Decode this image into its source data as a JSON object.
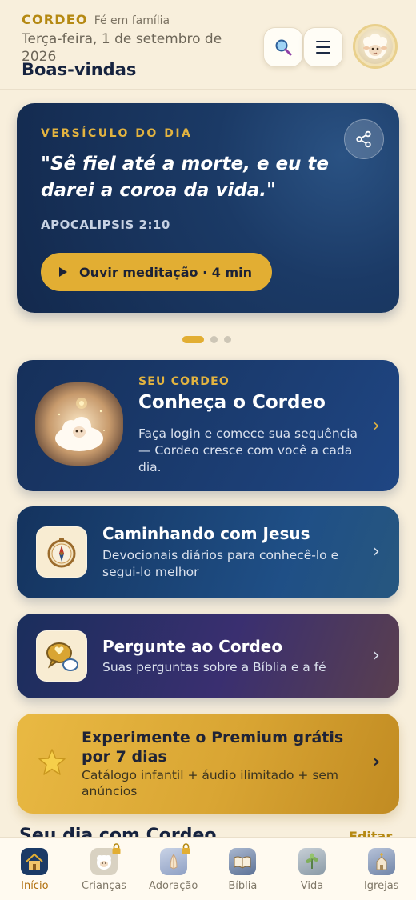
{
  "header": {
    "brand": "CORDEO",
    "tagline": "Fé em família",
    "date": "Terça-feira, 1 de setembro de 2026",
    "welcome": "Boas-vindas",
    "search_icon": "search-icon",
    "menu_icon": "menu-icon",
    "avatar_icon": "lamb-avatar-icon"
  },
  "verse": {
    "label": "VERSÍCULO DO DIA",
    "text": "\"Sê fiel até a morte, e eu te darei a coroa da vida.\"",
    "reference": "APOCALIPSIS 2:10",
    "listen_label": "Ouvir meditação · 4 min",
    "share_icon": "share-icon"
  },
  "carousel": {
    "pages": 3,
    "active": 1
  },
  "cordeo": {
    "eyebrow": "SEU CORDEO",
    "title": "Conheça o Cordeo",
    "description": "Faça login e comece sua sequência — Cordeo cresce com você a cada dia."
  },
  "features": [
    {
      "title": "Caminhando com Jesus",
      "description": "Devocionais diários para conhecê-lo e segui-lo melhor",
      "icon": "compass-icon"
    },
    {
      "title": "Pergunte ao Cordeo",
      "description": "Suas perguntas sobre a Bíblia e a fé",
      "icon": "chat-bubble-icon"
    }
  ],
  "premium": {
    "title": "Experimente o Premium grátis por 7 dias",
    "description": "Catálogo infantil + áudio ilimitado + sem anúncios",
    "icon": "star-icon"
  },
  "section": {
    "title": "Seu dia com Cordeo",
    "action": "Editar"
  },
  "nav": [
    {
      "label": "Início",
      "icon": "home-icon",
      "active": true,
      "locked": false
    },
    {
      "label": "Crianças",
      "icon": "lamb-icon",
      "active": false,
      "locked": true
    },
    {
      "label": "Adoração",
      "icon": "praying-hands-icon",
      "active": false,
      "locked": true
    },
    {
      "label": "Bíblia",
      "icon": "bible-icon",
      "active": false,
      "locked": false
    },
    {
      "label": "Vida",
      "icon": "plant-icon",
      "active": false,
      "locked": false
    },
    {
      "label": "Igrejas",
      "icon": "church-icon",
      "active": false,
      "locked": false
    }
  ],
  "colors": {
    "background": "#f8efdc",
    "accent_gold": "#e2ae33",
    "navy": "#16305a",
    "brand_text": "#b58913"
  }
}
